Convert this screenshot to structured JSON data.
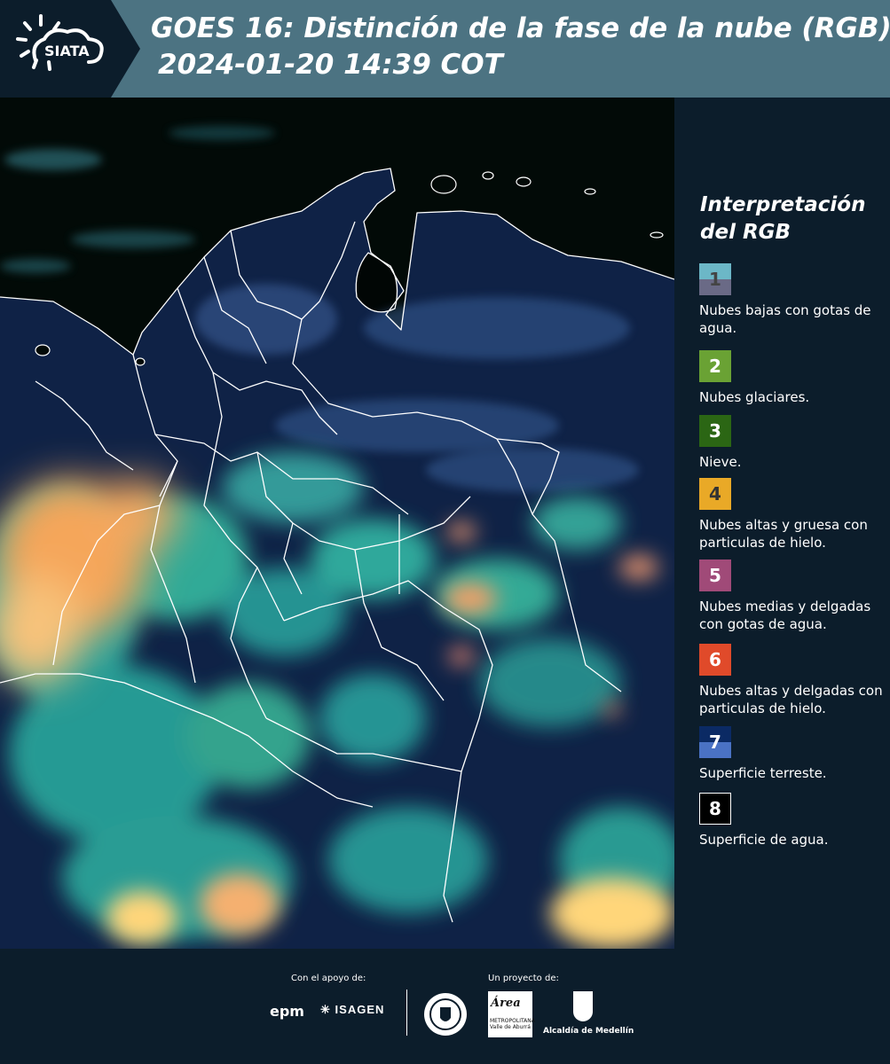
{
  "header": {
    "logo_text": "SIATA",
    "title_line_1": "GOES 16: Distinción de la fase de la nube (RGB)",
    "title_line_2": "2024-01-20 14:39 COT"
  },
  "legend": {
    "title_line_1": "Interpretación",
    "title_line_2": "del RGB",
    "items": [
      {
        "number": "1",
        "label": "Nubes bajas con gotas de agua.",
        "color_top": "#6cb7c7",
        "color_bottom": "#6a6a86",
        "number_color": "#444444"
      },
      {
        "number": "2",
        "label": "Nubes glaciares.",
        "color_top": "#6aa234",
        "color_bottom": "#6aa234",
        "number_color": "#ffffff"
      },
      {
        "number": "3",
        "label": "Nieve.",
        "color_top": "#2b6614",
        "color_bottom": "#2b6614",
        "number_color": "#ffffff"
      },
      {
        "number": "4",
        "label": "Nubes altas y gruesa con particulas de hielo.",
        "color_top": "#e9a927",
        "color_bottom": "#e9a927",
        "number_color": "#333333"
      },
      {
        "number": "5",
        "label": "Nubes medias y delgadas con gotas de agua.",
        "color_top": "#a04a78",
        "color_bottom": "#a04a78",
        "number_color": "#ffffff"
      },
      {
        "number": "6",
        "label": "Nubes altas y delgadas con particulas de hielo.",
        "color_top": "#e04a2a",
        "color_bottom": "#e04a2a",
        "number_color": "#ffffff"
      },
      {
        "number": "7",
        "label": "Superficie terreste.",
        "color_top": "#0b2a64",
        "color_bottom": "#4a72c4",
        "number_color": "#ffffff"
      },
      {
        "number": "8",
        "label": "Superficie de agua.",
        "color_top": "#000000",
        "color_bottom": "#000000",
        "number_color": "#ffffff"
      }
    ]
  },
  "footer": {
    "support_caption": "Con el apoyo de:",
    "project_caption": "Un proyecto de:",
    "sponsor_1": "epm",
    "sponsor_2": "ISAGEN",
    "partner_1": "Área",
    "partner_1_sub": "METROPOLITANA Valle de Aburrá",
    "partner_2": "Alcaldía de Medellín"
  },
  "colors": {
    "header_bg": "#4c7382",
    "page_bg": "#0c1d2b",
    "ocean": "#020a07",
    "land": "#0f2246",
    "border": "#ffffff"
  }
}
